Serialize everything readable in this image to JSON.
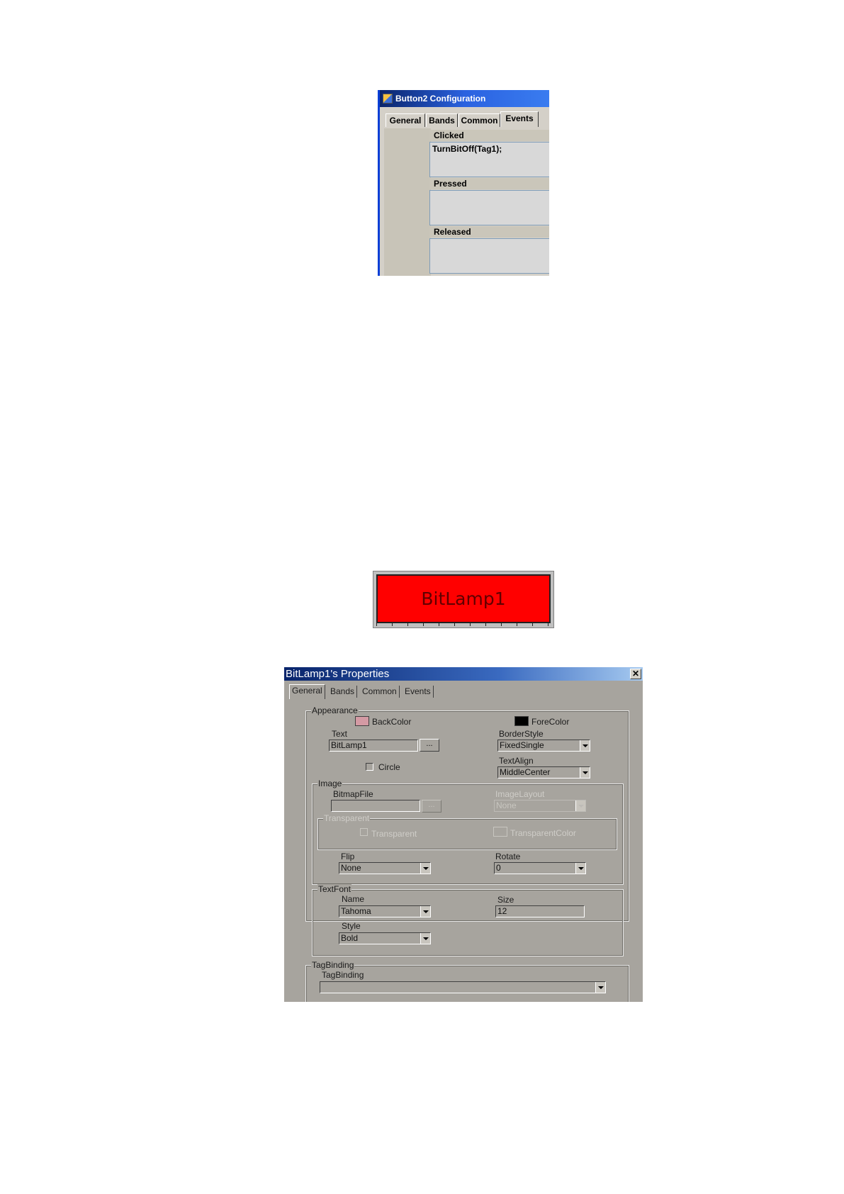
{
  "button_config": {
    "title": "Button2 Configuration",
    "tabs": [
      "General",
      "Bands",
      "Common",
      "Events"
    ],
    "active_tab": "Events",
    "events": [
      {
        "label": "Clicked",
        "script": "TurnBitOff(Tag1);"
      },
      {
        "label": "Pressed",
        "script": ""
      },
      {
        "label": "Released",
        "script": ""
      }
    ]
  },
  "bitlamp": {
    "text": "BitLamp1",
    "back_color": "#ff0000"
  },
  "properties": {
    "title": "BitLamp1's Properties",
    "close": "✕",
    "tabs": [
      "General",
      "Bands",
      "Common",
      "Events"
    ],
    "active_tab": "General",
    "appearance": {
      "legend": "Appearance",
      "back_color_label": "BackColor",
      "back_color": "#d49aa4",
      "fore_color_label": "ForeColor",
      "fore_color": "#000000",
      "text_label": "Text",
      "text_value": "BitLamp1",
      "browse": "...",
      "circle_label": "Circle",
      "border_style_label": "BorderStyle",
      "border_style": "FixedSingle",
      "text_align_label": "TextAlign",
      "text_align": "MiddleCenter"
    },
    "image": {
      "legend": "Image",
      "bitmap_label": "BitmapFile",
      "bitmap_value": "",
      "browse": "...",
      "layout_label": "ImageLayout",
      "layout_value": "None",
      "transparent_legend": "Transparent",
      "transparent_label": "Transparent",
      "transparent_color_label": "TransparentColor",
      "flip_label": "Flip",
      "flip_value": "None",
      "rotate_label": "Rotate",
      "rotate_value": "0"
    },
    "text_font": {
      "legend": "TextFont",
      "name_label": "Name",
      "name_value": "Tahoma",
      "size_label": "Size",
      "size_value": "12",
      "style_label": "Style",
      "style_value": "Bold"
    },
    "tag_binding": {
      "legend": "TagBinding",
      "label": "TagBinding",
      "value": ""
    }
  }
}
